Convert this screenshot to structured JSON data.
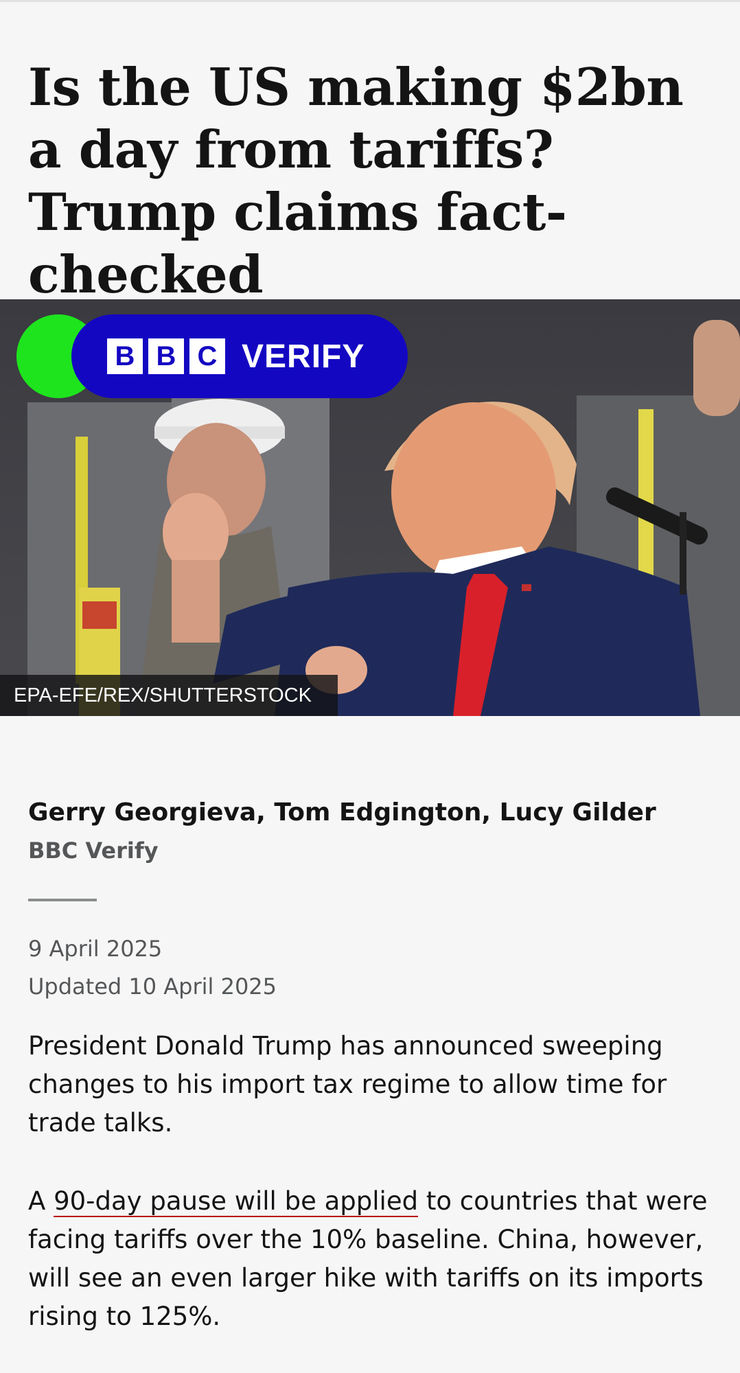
{
  "article": {
    "headline": "Is the US making $2bn a day from tariffs? Trump claims fact-checked",
    "hero": {
      "badge": {
        "bbc_letters": [
          "B",
          "B",
          "C"
        ],
        "label": "VERIFY",
        "colors": {
          "pill": "#1407c2",
          "dot": "#1ee41e"
        }
      },
      "photo_credit": "EPA-EFE/REX/SHUTTERSTOCK"
    },
    "byline": {
      "authors": "Gerry Georgieva, Tom Edgington, Lucy Gilder",
      "team": "BBC Verify"
    },
    "dates": {
      "published": "9 April 2025",
      "updated": "Updated 10 April 2025"
    },
    "body": {
      "para1": "President Donald Trump has announced sweeping changes to his import tax regime to allow time for trade talks.",
      "para2": {
        "before": "A ",
        "link": "90-day pause will be applied",
        "after": " to countries that were facing tariffs over the 10% baseline. China, however, will see an even larger hike with tariffs on its imports rising to 125%."
      }
    }
  },
  "colors": {
    "background": "#f6f6f6",
    "text": "#141414",
    "muted": "#545658",
    "link_underline": "#b80000"
  }
}
